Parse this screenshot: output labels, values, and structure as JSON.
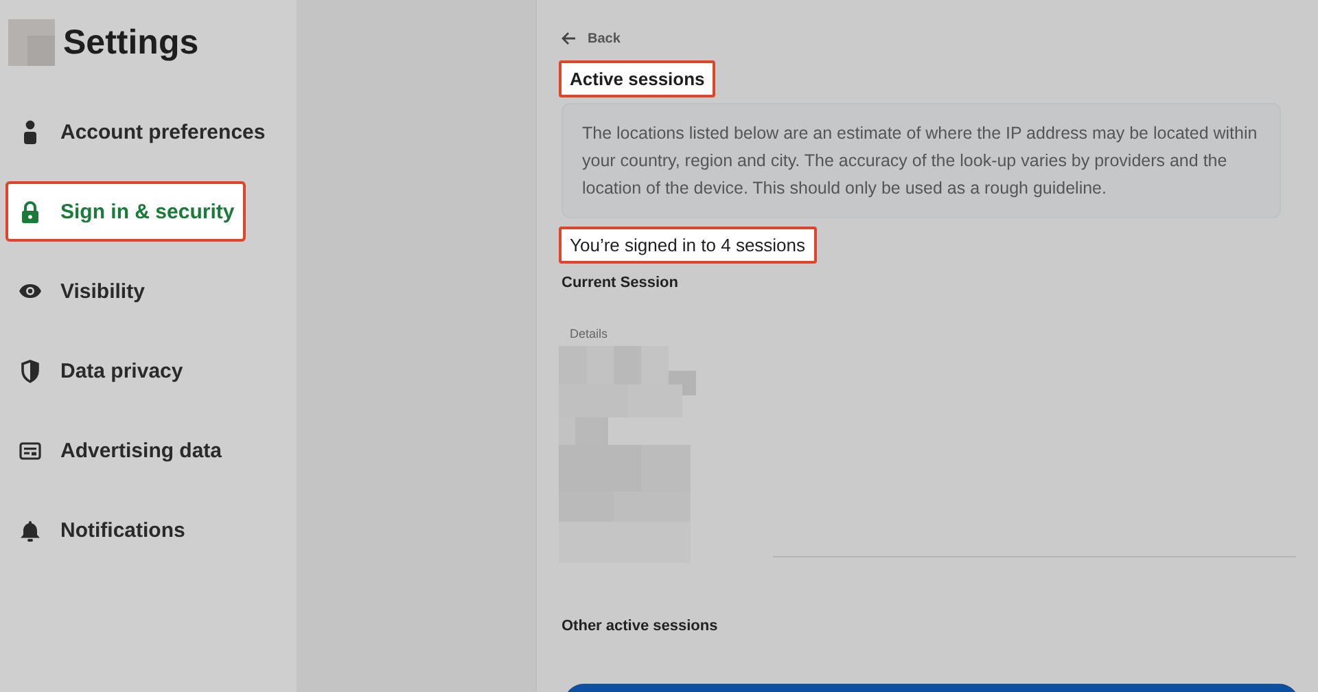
{
  "sidebar": {
    "title": "Settings",
    "items": [
      {
        "label": "Account preferences",
        "kind": "person",
        "selected": false
      },
      {
        "label": "Sign in & security",
        "kind": "lock",
        "selected": true
      },
      {
        "label": "Visibility",
        "kind": "eye",
        "selected": false
      },
      {
        "label": "Data privacy",
        "kind": "shield",
        "selected": false
      },
      {
        "label": "Advertising data",
        "kind": "card",
        "selected": false
      },
      {
        "label": "Notifications",
        "kind": "bell",
        "selected": false
      }
    ]
  },
  "main": {
    "back": "Back",
    "title": "Active sessions",
    "notice": "The locations listed below are an estimate of where the IP address may be located within your country, region and city. The accuracy of the look-up varies by providers and the location of the device. This should only be used as a rough guideline.",
    "summary": "You’re signed in to 4 sessions",
    "current_heading": "Current Session",
    "details_label": "Details",
    "other_heading": "Other active sessions"
  }
}
